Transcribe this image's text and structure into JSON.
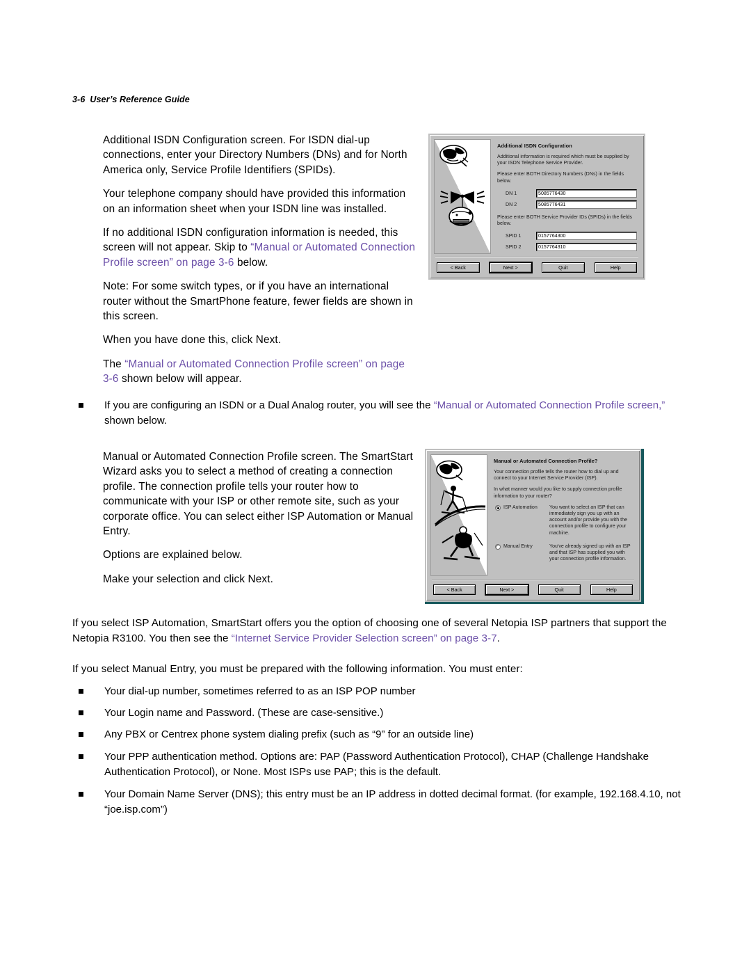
{
  "header": {
    "page_number": "3-6",
    "title": "User’s Reference Guide"
  },
  "body": {
    "p1": "Additional ISDN Configuration screen. For ISDN dial-up connections, enter your Directory Numbers (DNs) and for North America only, Service Profile Identifiers (SPIDs).",
    "p2": "Your telephone company should have provided this information on an information sheet when your ISDN line was installed.",
    "p3_pre": "If no additional ISDN configuration information is needed, this screen will not appear. Skip to ",
    "p3_link": "“Manual or Automated Connection Profile screen” on page 3-6",
    "p3_post": " below.",
    "p4": "Note: For some switch types, or if you have an international router without the SmartPhone feature, fewer fields are shown in this screen.",
    "p5": "When you have done this, click Next.",
    "p6_pre": "The ",
    "p6_link": "“Manual or Automated Connection Profile screen” on page 3-6",
    "p6_post": " shown below will appear.",
    "bullet1_pre": "If you are configuring an ISDN or a Dual Analog router, you will see the ",
    "bullet1_link": "“Manual or Automated Connection Profile screen,”",
    "bullet1_post": " shown below.",
    "p7": "Manual or Automated Connection Profile screen. The SmartStart Wizard asks you to select a method of creating a connection profile. The connection profile tells your router how to communicate with your ISP or other remote site, such as your corporate office. You can select either ISP Automation or Manual Entry.",
    "p8": "Options are explained below.",
    "p9": "Make your selection and click Next.",
    "p10_pre": "If you select ISP Automation, SmartStart offers you the option of choosing one of several Netopia ISP partners that support the Netopia R3100. You then see the ",
    "p10_link": "“Internet Service Provider Selection screen” on page 3-7",
    "p10_post": ".",
    "p11": "If you select Manual Entry, you must be prepared with the following information. You must enter:",
    "bullets": [
      "Your dial-up number, sometimes referred to as an ISP POP number",
      "Your Login name and Password. (These are case-sensitive.)",
      "Any PBX or Centrex phone system dialing prefix (such as “9” for an outside line)",
      "Your PPP authentication method. Options are: PAP (Password Authentication Protocol), CHAP (Challenge Handshake Authentication Protocol), or None. Most ISPs use PAP; this is the default.",
      "Your Domain Name Server (DNS); this entry must be an IP address in dotted decimal format. (for example, 192.168.4.10, not “joe.isp.com”)"
    ]
  },
  "dialog_isdn": {
    "heading": "Additional ISDN Configuration",
    "intro": "Additional information is required which must be supplied by your ISDN Telephone Service Provider.",
    "dn_prompt": "Please enter BOTH Directory Numbers (DNs) in the fields below.",
    "dn1_label": "DN 1",
    "dn1_value": "5085776430",
    "dn2_label": "DN 2",
    "dn2_value": "5085776431",
    "spid_prompt": "Please enter BOTH Service Provider IDs (SPIDs) in the fields below.",
    "spid1_label": "SPID 1",
    "spid1_value": "0157764300",
    "spid2_label": "SPID 2",
    "spid2_value": "0157764310",
    "buttons": {
      "back": "< Back",
      "next": "Next >",
      "quit": "Quit",
      "help": "Help"
    }
  },
  "dialog_profile": {
    "heading": "Manual or Automated Connection Profile?",
    "intro": "Your connection profile tells the router how to dial up and connect to your Internet Service Provider (ISP).",
    "question": "In what manner would you like to supply connection profile information to your router?",
    "option1_label": "ISP Automation",
    "option1_desc": "You want to select an ISP that can immediately sign you up with an account and/or provide you with the connection profile to configure your machine.",
    "option2_label": "Manual Entry",
    "option2_desc": "You've already signed up with an ISP and that ISP has supplied you with your connection profile information.",
    "selected": "option1",
    "buttons": {
      "back": "< Back",
      "next": "Next >",
      "quit": "Quit",
      "help": "Help"
    }
  },
  "colors": {
    "link": "#6B4FA8",
    "dialog_face": "#c0c0c0",
    "teal_edge": "#17585c"
  }
}
